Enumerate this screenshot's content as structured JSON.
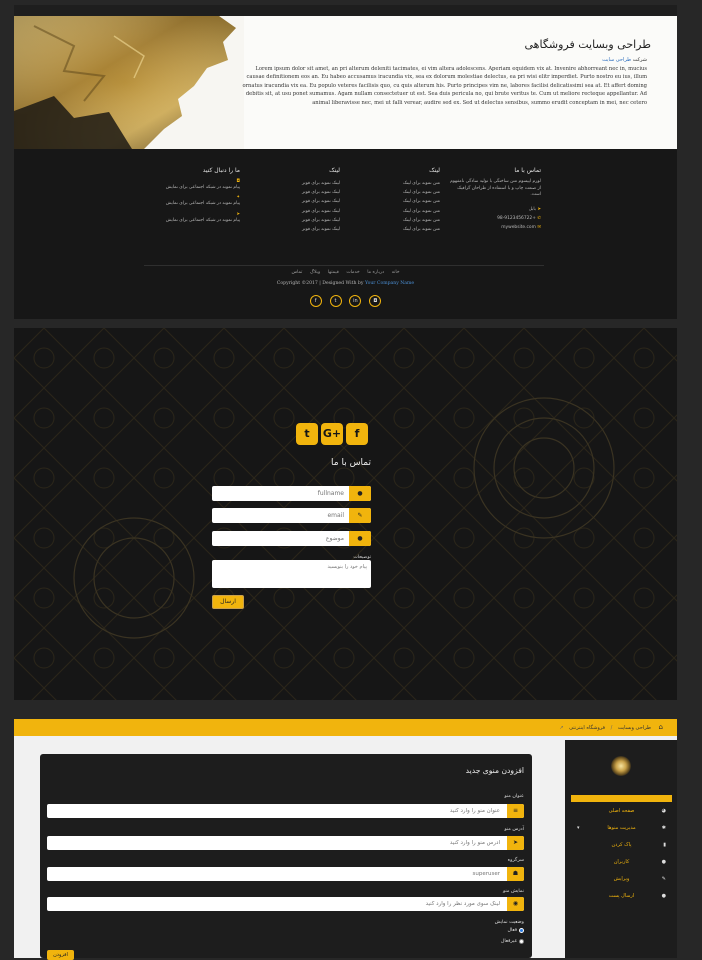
{
  "hero": {
    "title": "طراحی وبسایت فروشگاهی",
    "subtitle_prefix": "شرکت",
    "subtitle_link": "طراحی سایت",
    "lorem": "Lorem ipsum dolor sit amet, an pri alterum deleniti tacimates, ei vim altera adolescens. Aperiam equidem vix at. Invenire abhorreant nec in, mucius causae definitionem eos an. Eu habeo accusamus iracundia vix, sea ex dolorum molestiae delectus, ea pri wisi elitr imperdiet. Purto nostro eu ius, illum ornatus iracundia vix ea. Eu populo veteres facilisis quo, cu quis alterum his. Purto principes vim ne, labores facilisi delicatissimi sea at. Et affert doming debitis sit, at usu ponet sumamus. Agam nullam consectetuer ut est. Sea duis pericula no, qui brute veritus te. Cum ut meliore recteque appellantur. Ad animal liberavisse nec, mei ut falli verear, audire sed ex. Sed ut delectus sensibus, summo erudit conceptam in mei, nec cetero"
  },
  "footer": {
    "contact": {
      "heading": "تماس با ما",
      "desc": "لورم ایپسوم متن ساختگی با تولید سادگی نامفهوم از صنعت چاپ و با استفاده از طراحان گرافیک است.",
      "address": "بابل",
      "phone": "+98-9123456722",
      "email": "mywebsite.com"
    },
    "links1": {
      "heading": "لینک",
      "items": [
        "متن نمونه برای لینک",
        "متن نمونه برای لینک",
        "متن نمونه برای لینک",
        "متن نمونه برای لینک",
        "متن نمونه برای لینک",
        "متن نمونه برای لینک"
      ]
    },
    "links2": {
      "heading": "لینک",
      "items": [
        "لینک نمونه برای فوتر",
        "لینک نمونه برای فوتر",
        "لینک نمونه برای فوتر",
        "لینک نمونه برای فوتر",
        "لینک نمونه برای فوتر",
        "لینک نمونه برای فوتر"
      ]
    },
    "follow": {
      "heading": "ما را دنبال کنید",
      "items": [
        "پیام نمونه در شبکه اجتماعی برای نمایش",
        "پیام نمونه در شبکه اجتماعی برای نمایش",
        "پیام نمونه در شبکه اجتماعی برای نمایش"
      ]
    },
    "nav": [
      "خانه",
      "درباره ما",
      "خدمات",
      "قیمتها",
      "وبلاگ",
      "تماس"
    ],
    "copyright_prefix": "Copyright ©2017 | Designed With by",
    "copyright_link": "Your Company Name",
    "socials": [
      "facebook-icon",
      "twitter-icon",
      "linkedin-icon",
      "instagram-icon"
    ]
  },
  "contact_form": {
    "title": "تماس با ما",
    "fullname_placeholder": "fullname",
    "email_placeholder": "email",
    "subject_placeholder": "موضوع",
    "message_label": "توضیحات",
    "message_placeholder": "پیام خود را بنویسید",
    "send_label": "ارسال"
  },
  "admin": {
    "breadcrumb": [
      "طراحی وبسایت",
      "فروشگاه اینترنتی"
    ],
    "form_title": "افزودن منوی جدید",
    "fields": [
      {
        "label": "عنوان منو",
        "placeholder": "عنوان منو را وارد کنید",
        "icon": "list-icon"
      },
      {
        "label": "آدرس منو",
        "placeholder": "آدرس منو را وارد کنید",
        "icon": "send-icon"
      },
      {
        "label": "سرگروه",
        "placeholder": "superuser",
        "icon": "users-icon"
      },
      {
        "label": "نمایش منو",
        "placeholder": "لینک سوی مورد نظر را وارد کنید",
        "icon": "eye-icon"
      }
    ],
    "status_label": "وضعیت نمایش",
    "status_active": "فعال",
    "status_inactive": "غیرفعال",
    "submit_label": "افزودن",
    "sidebar": [
      "صفحه اصلی",
      "مدیریت منوها",
      "پاک کردن",
      "کاربران",
      "ویرایش",
      "ارسال پست"
    ]
  }
}
